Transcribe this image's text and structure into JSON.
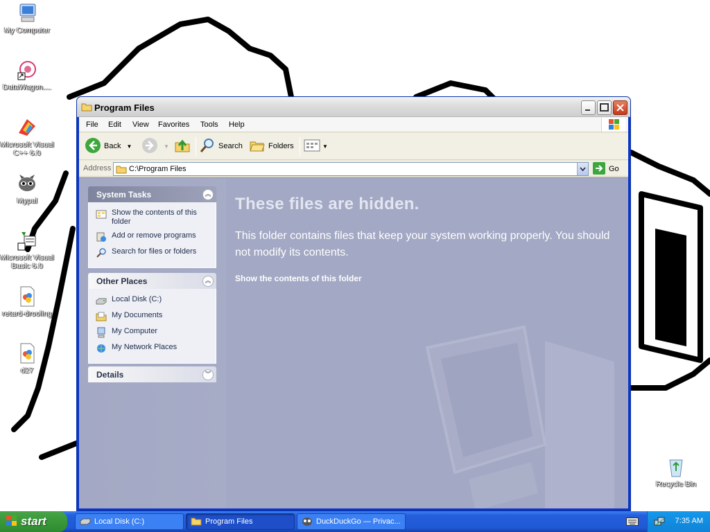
{
  "desktop": {
    "icons": [
      {
        "label": "My Computer",
        "icon": "my-computer-icon"
      },
      {
        "label": "DataWagon....",
        "icon": "datawagon-icon"
      },
      {
        "label": "Microsoft Visual C++ 6.0",
        "icon": "visual-cpp-icon"
      },
      {
        "label": "Mypal",
        "icon": "mypal-icon"
      },
      {
        "label": "Microsoft Visual Basic 6.0",
        "icon": "visual-basic-icon"
      },
      {
        "label": "retard-drooling",
        "icon": "image-file-icon"
      },
      {
        "label": "d27",
        "icon": "image-file-icon"
      },
      {
        "label": "Recycle Bin",
        "icon": "recycle-bin-icon"
      }
    ]
  },
  "window": {
    "title": "Program Files",
    "menu": [
      "File",
      "Edit",
      "View",
      "Favorites",
      "Tools",
      "Help"
    ],
    "toolbar": {
      "back_label": "Back",
      "search_label": "Search",
      "folders_label": "Folders"
    },
    "address": {
      "label": "Address",
      "value": "C:\\Program Files",
      "go_label": "Go"
    },
    "task_pane": {
      "system_tasks": {
        "heading": "System Tasks",
        "items": [
          {
            "label": "Show the contents of this folder",
            "icon": "show-contents-icon"
          },
          {
            "label": "Add or remove programs",
            "icon": "add-remove-programs-icon"
          },
          {
            "label": "Search for files or folders",
            "icon": "search-icon"
          }
        ]
      },
      "other_places": {
        "heading": "Other Places",
        "items": [
          {
            "label": "Local Disk (C:)",
            "icon": "local-disk-icon"
          },
          {
            "label": "My Documents",
            "icon": "my-documents-icon"
          },
          {
            "label": "My Computer",
            "icon": "my-computer-icon"
          },
          {
            "label": "My Network Places",
            "icon": "network-places-icon"
          }
        ]
      },
      "details": {
        "heading": "Details"
      }
    },
    "main": {
      "title": "These files are hidden.",
      "description": "This folder contains files that keep your system working properly. You should not modify its contents.",
      "link": "Show the contents of this folder"
    }
  },
  "taskbar": {
    "start_label": "start",
    "tasks": [
      {
        "label": "Local Disk (C:)",
        "active": false
      },
      {
        "label": "Program Files",
        "active": true
      },
      {
        "label": "DuckDuckGo — Privac...",
        "active": false
      }
    ],
    "clock": "7:35 AM"
  }
}
